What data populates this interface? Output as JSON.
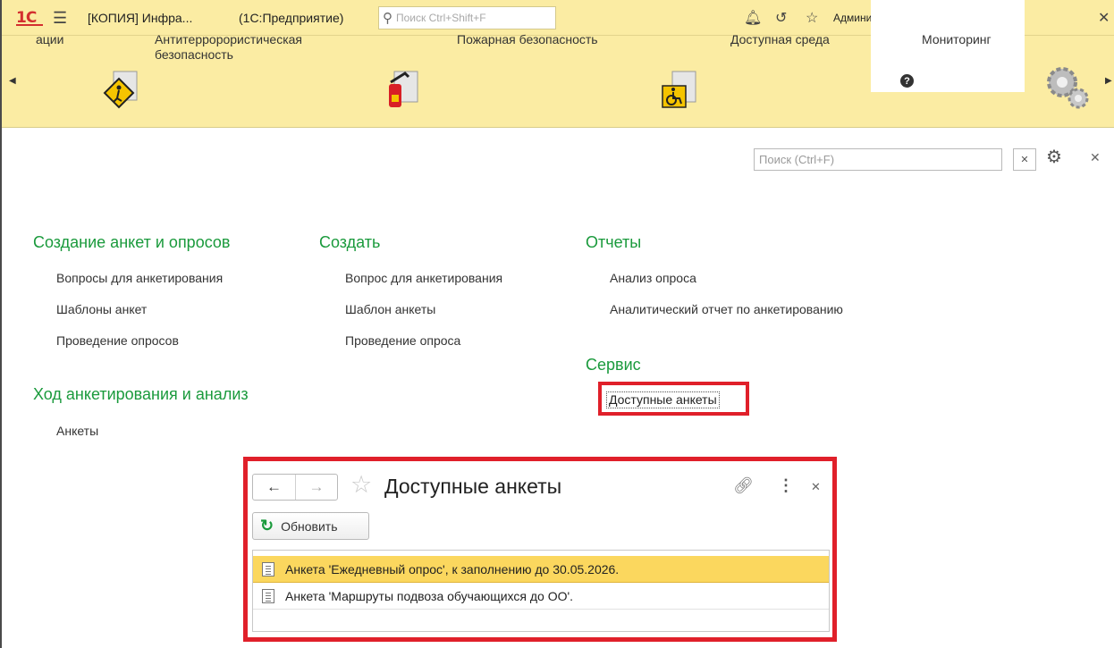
{
  "titlebar": {
    "logo": "1С",
    "title": "[КОПИЯ] Инфра...",
    "app": "(1С:Предприятие)",
    "search_placeholder": "Поиск Ctrl+Shift+F",
    "user": "Администратор"
  },
  "sections": [
    {
      "label": "ации",
      "icon": "folder-icon"
    },
    {
      "label": "Антитерророристическая безопасность",
      "icon": "hazard-sign-icon"
    },
    {
      "label": "Пожарная безопасность",
      "icon": "fire-extinguisher-icon"
    },
    {
      "label": "Доступная среда",
      "icon": "wheelchair-icon"
    },
    {
      "label": "Мониторинг",
      "icon": "help-icon",
      "active": true
    },
    {
      "label": "",
      "icon": "gears-icon"
    }
  ],
  "toolbar": {
    "search_placeholder": "Поиск (Ctrl+F)"
  },
  "groups": {
    "create_surveys": {
      "title": "Создание анкет и опросов",
      "items": [
        "Вопросы для анкетирования",
        "Шаблоны анкет",
        "Проведение опросов"
      ]
    },
    "progress": {
      "title": "Ход анкетирования и анализ",
      "items": [
        "Анкеты"
      ]
    },
    "create": {
      "title": "Создать",
      "items": [
        "Вопрос для анкетирования",
        "Шаблон анкеты",
        "Проведение опроса"
      ]
    },
    "reports": {
      "title": "Отчеты",
      "items": [
        "Анализ опроса",
        "Аналитический отчет по анкетированию"
      ]
    },
    "service": {
      "title": "Сервис",
      "items": [
        "Доступные анкеты"
      ]
    }
  },
  "popup": {
    "title": "Доступные анкеты",
    "refresh_label": "Обновить",
    "rows": [
      "Анкета 'Ежедневный опрос', к заполнению до 30.05.2026.",
      "Анкета 'Маршруты подвоза обучающихся до ОО'."
    ]
  },
  "colors": {
    "panel": "#fbeca3",
    "group_title": "#1a9a3c",
    "highlight": "#e0202a",
    "selected_row": "#fbd75e"
  }
}
